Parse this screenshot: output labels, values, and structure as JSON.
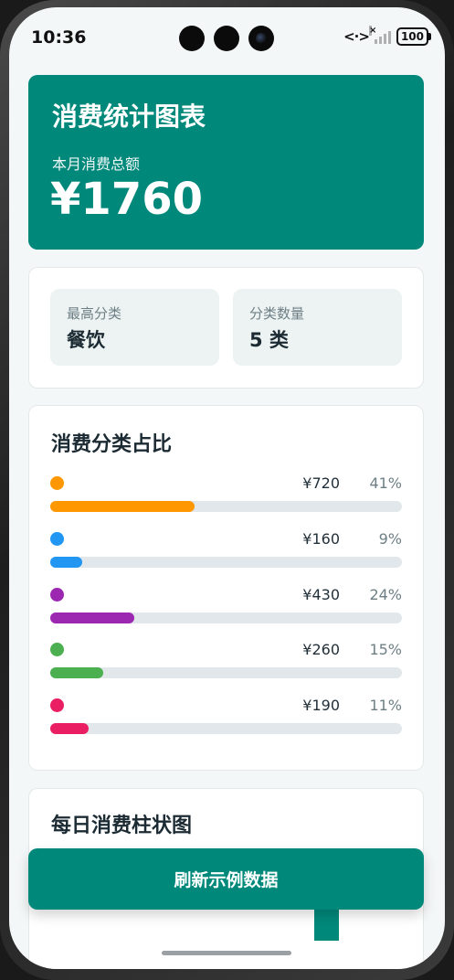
{
  "status_bar": {
    "time": "10:36",
    "nfc_icon": "<·>",
    "battery": "100"
  },
  "hero": {
    "title": "消费统计图表",
    "subtitle": "本月消费总额",
    "total": "¥1760"
  },
  "info": {
    "top_category_label": "最高分类",
    "top_category_value": "餐饮",
    "count_label": "分类数量",
    "count_value": "5 类"
  },
  "categories": {
    "title": "消费分类占比",
    "items": [
      {
        "amount": "¥720",
        "percent": "41%",
        "fraction": 0.41,
        "color": "#ff9800"
      },
      {
        "amount": "¥160",
        "percent": "9%",
        "fraction": 0.09,
        "color": "#2196f3"
      },
      {
        "amount": "¥430",
        "percent": "24%",
        "fraction": 0.24,
        "color": "#9c27b0"
      },
      {
        "amount": "¥260",
        "percent": "15%",
        "fraction": 0.15,
        "color": "#4caf50"
      },
      {
        "amount": "¥190",
        "percent": "11%",
        "fraction": 0.11,
        "color": "#e91e63"
      }
    ]
  },
  "bar_chart": {
    "title": "每日消费柱状图"
  },
  "refresh_button": "刷新示例数据",
  "colors": {
    "accent": "#00897b",
    "background": "#f4f7f7"
  }
}
